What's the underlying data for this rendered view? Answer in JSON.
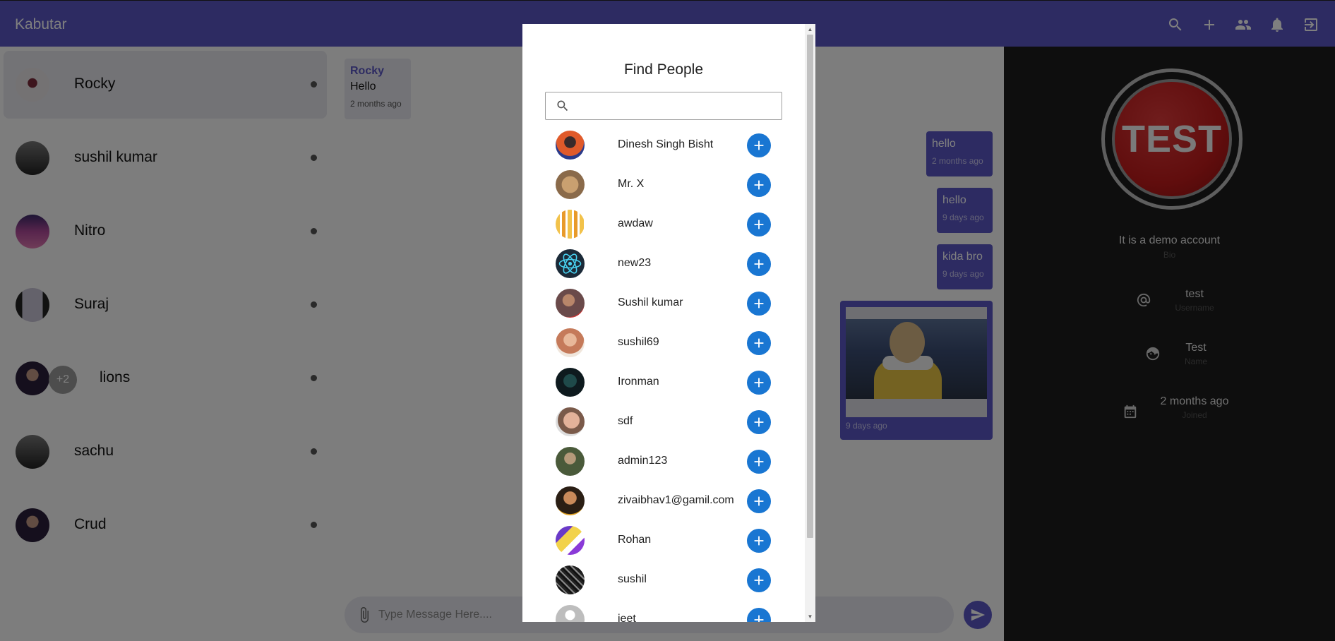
{
  "app": {
    "title": "Kabutar"
  },
  "toolbar": {
    "icons": [
      "search-icon",
      "plus-icon",
      "people-icon",
      "bell-icon",
      "logout-icon"
    ]
  },
  "sidebar": {
    "chats": [
      {
        "name": "Rocky"
      },
      {
        "name": "sushil kumar"
      },
      {
        "name": "Nitro"
      },
      {
        "name": "Suraj"
      },
      {
        "name": "lions",
        "extra_members": "+2"
      },
      {
        "name": "sachu"
      },
      {
        "name": "Crud"
      }
    ]
  },
  "chat": {
    "incoming": {
      "sender": "Rocky",
      "text": "Hello",
      "time": "2 months ago"
    },
    "outgoing": [
      {
        "text": "hello",
        "time": "2 months ago"
      },
      {
        "text": "hello",
        "time": "9 days ago"
      },
      {
        "text": "kida bro",
        "time": "9 days ago"
      }
    ],
    "image_message": {
      "time": "9 days ago"
    },
    "composer": {
      "placeholder": "Type Message Here...."
    }
  },
  "profile": {
    "avatar_text": "TEST",
    "bio": "It is a demo account",
    "bio_label": "Bio",
    "username": "test",
    "username_label": "Username",
    "name": "Test",
    "name_label": "Name",
    "joined": "2 months ago",
    "joined_label": "Joined"
  },
  "modal": {
    "title": "Find People",
    "search_value": "",
    "people": [
      "Dinesh Singh Bisht",
      "Mr. X",
      "awdaw",
      "new23",
      "Sushil kumar",
      "sushil69",
      "Ironman",
      "sdf",
      "admin123",
      "zivaibhav1@gamil.com",
      "Rohan",
      "sushil",
      "jeet"
    ]
  },
  "colors": {
    "appbar": "#5b57c4",
    "add_button": "#1976d2",
    "profile_bg": "#1c1c1c"
  }
}
